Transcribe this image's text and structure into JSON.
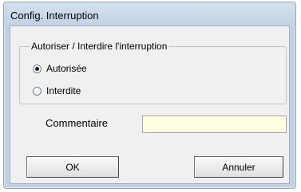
{
  "dialog": {
    "title": "Config. Interruption"
  },
  "group": {
    "legend": "Autoriser / Interdire l'interruption",
    "options": [
      {
        "label": "Autorisée",
        "checked": true
      },
      {
        "label": "Interdite",
        "checked": false
      }
    ]
  },
  "comment": {
    "label": "Commentaire",
    "value": ""
  },
  "buttons": {
    "ok_label": "OK",
    "cancel_label": "Annuler"
  },
  "colors": {
    "title_bar": "#c2d2e4",
    "dialog_background": "#f0f0f0",
    "comment_field_background": "#ffffe1"
  }
}
